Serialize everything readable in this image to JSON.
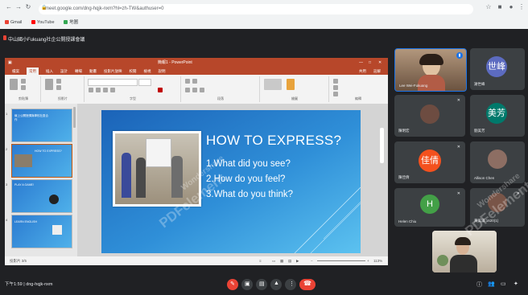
{
  "browser": {
    "url": "meet.google.com/dng-hqjk-nxm?hl=zh-TW&authuser=0",
    "bookmarks": [
      {
        "label": "Gmail",
        "icon": "gmail-icon"
      },
      {
        "label": "YouTube",
        "icon": "youtube-icon"
      },
      {
        "label": "地圖",
        "icon": "maps-icon"
      }
    ]
  },
  "meeting": {
    "title": "中山國小Fukuang社企公開授課會議",
    "time_code": "下午1:59 | dng-hqjk-nxm"
  },
  "ppt": {
    "title": "簡報1 - PowerPoint",
    "tabs": [
      "檔案",
      "常用",
      "插入",
      "設計",
      "轉場",
      "動畫",
      "投影片放映",
      "校閱",
      "檢視",
      "說明"
    ],
    "active_tab": "常用",
    "share": "共用",
    "comment": "註解",
    "ribbon_groups": [
      "剪貼簿",
      "投影片",
      "字型",
      "段落",
      "繪圖",
      "編輯"
    ],
    "status": "投影片 3/5",
    "zoom": "113%",
    "thumbnails": [
      {
        "num": "1",
        "title": "線上公開授課與學校社區合作"
      },
      {
        "num": "2",
        "title": "HOW TO EXPRESS?"
      },
      {
        "num": "3",
        "title": "PLAY A GAME!"
      },
      {
        "num": "4",
        "title": ""
      },
      {
        "num": "5",
        "title": "LEARN ENGLISH"
      }
    ]
  },
  "slide": {
    "heading": "HOW TO EXPRESS?",
    "bullets": [
      "1.What did you see?",
      "2.How do you feel?",
      "3.What do you think?"
    ]
  },
  "participants": [
    {
      "name": "Lee Wei-Fukuang",
      "avatar": "",
      "color": "#5f4b3a"
    },
    {
      "name": "謝世峰",
      "avatar": "世峰",
      "color": "#5c6bc0"
    },
    {
      "name": "陳明宏",
      "avatar": "",
      "color": "#6d4c41"
    },
    {
      "name": "劉美芳",
      "avatar": "美芳",
      "color": "#00796b"
    },
    {
      "name": "陳佳倩",
      "avatar": "佳倩",
      "color": "#f4511e"
    },
    {
      "name": "Allison Chen",
      "avatar": "",
      "color": "#8d6e63"
    },
    {
      "name": "Helen Chiu",
      "avatar": "H",
      "color": "#43a047"
    },
    {
      "name": "黃美滿 1620(1)",
      "avatar": "",
      "color": "#795548"
    }
  ],
  "watermark": {
    "brand": "Wondershare",
    "product": "PDFelement"
  }
}
